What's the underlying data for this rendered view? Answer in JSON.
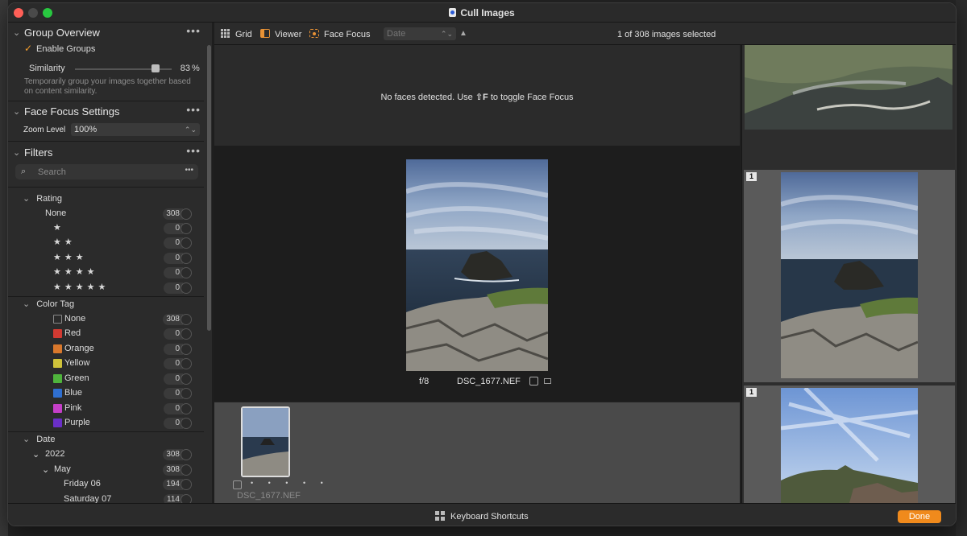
{
  "window": {
    "title": "Cull Images"
  },
  "group_overview": {
    "title": "Group Overview",
    "enable_groups_label": "Enable Groups",
    "enable_groups_checked": true,
    "similarity_label": "Similarity",
    "similarity_value": "83",
    "similarity_unit": "%",
    "similarity_level": 0.83,
    "description": "Temporarily group your images together based on content similarity."
  },
  "face_focus_settings": {
    "title": "Face Focus Settings",
    "zoom_label": "Zoom Level",
    "zoom_value": "100%"
  },
  "filters": {
    "title": "Filters",
    "search_placeholder": "Search",
    "rating": {
      "label": "Rating",
      "items": [
        {
          "label": "None",
          "count": "308"
        },
        {
          "label": "★",
          "count": "0"
        },
        {
          "label": "★★",
          "count": "0"
        },
        {
          "label": "★★★",
          "count": "0"
        },
        {
          "label": "★★★★",
          "count": "0"
        },
        {
          "label": "★★★★★",
          "count": "0"
        }
      ]
    },
    "color_tag": {
      "label": "Color Tag",
      "items": [
        {
          "label": "None",
          "count": "308",
          "color": "none"
        },
        {
          "label": "Red",
          "count": "0",
          "color": "#d23a32"
        },
        {
          "label": "Orange",
          "count": "0",
          "color": "#d9782c"
        },
        {
          "label": "Yellow",
          "count": "0",
          "color": "#cfc23a"
        },
        {
          "label": "Green",
          "count": "0",
          "color": "#4fb43c"
        },
        {
          "label": "Blue",
          "count": "0",
          "color": "#2f6fd0"
        },
        {
          "label": "Pink",
          "count": "0",
          "color": "#c53fc8"
        },
        {
          "label": "Purple",
          "count": "0",
          "color": "#6a2fc7"
        }
      ]
    },
    "date": {
      "label": "Date",
      "year": {
        "label": "2022",
        "count": "308"
      },
      "month": {
        "label": "May",
        "count": "308"
      },
      "days": [
        {
          "label": "Friday 06",
          "count": "194"
        },
        {
          "label": "Saturday 07",
          "count": "114"
        }
      ]
    }
  },
  "toolbar": {
    "grid_label": "Grid",
    "viewer_label": "Viewer",
    "face_focus_label": "Face Focus",
    "sort_value": "Date",
    "selection_status": "1 of 308 images selected"
  },
  "face_pane": {
    "message_prefix": "No faces detected. Use ",
    "shortcut": "⇧F",
    "message_suffix": " to toggle Face Focus"
  },
  "viewer": {
    "aperture": "f/8",
    "filename": "DSC_1677.NEF"
  },
  "filmstrip": {
    "filename": "DSC_1677.NEF",
    "rating_dots": "• • • • •"
  },
  "right_column": {
    "group_badges": [
      "1",
      "1"
    ]
  },
  "bottom_bar": {
    "shortcuts_label": "Keyboard Shortcuts",
    "done_label": "Done"
  },
  "colors": {
    "accent": "#f08a1c",
    "checkmark": "#f29b2b"
  }
}
